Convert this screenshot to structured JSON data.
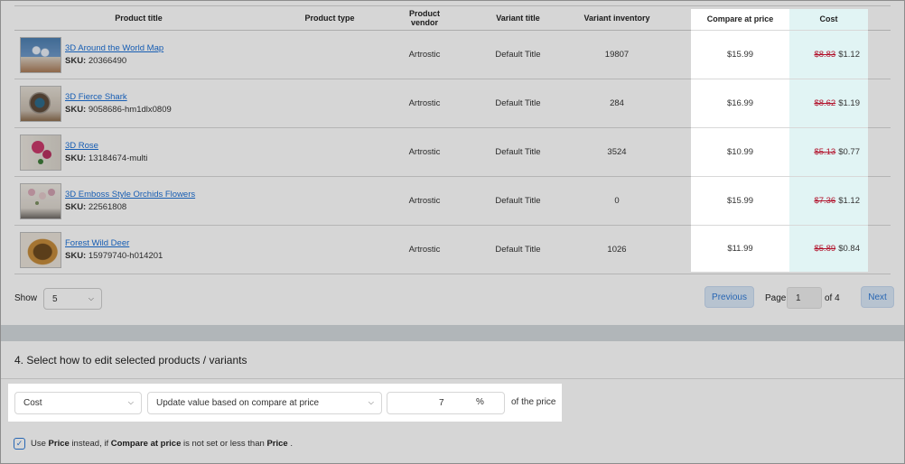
{
  "table": {
    "headers": {
      "title": "Product title",
      "type": "Product type",
      "vendor": "Product vendor",
      "variant_title": "Variant title",
      "inventory": "Variant inventory",
      "compare_at": "Compare at price",
      "cost": "Cost"
    },
    "rows": [
      {
        "title": "3D Around the World Map",
        "sku_label": "SKU:",
        "sku": "20366490",
        "type": "",
        "vendor": "Artrostic",
        "variant_title": "Default Title",
        "inventory": "19807",
        "compare_at": "$15.99",
        "cost_old": "$8.83",
        "cost_new": "$1.12"
      },
      {
        "title": "3D Fierce Shark",
        "sku_label": "SKU:",
        "sku": "9058686-hm1dlx0809",
        "type": "",
        "vendor": "Artrostic",
        "variant_title": "Default Title",
        "inventory": "284",
        "compare_at": "$16.99",
        "cost_old": "$8.62",
        "cost_new": "$1.19"
      },
      {
        "title": "3D Rose",
        "sku_label": "SKU:",
        "sku": "13184674-multi",
        "type": "",
        "vendor": "Artrostic",
        "variant_title": "Default Title",
        "inventory": "3524",
        "compare_at": "$10.99",
        "cost_old": "$5.13",
        "cost_new": "$0.77"
      },
      {
        "title": "3D Emboss Style Orchids Flowers",
        "sku_label": "SKU:",
        "sku": "22561808",
        "type": "",
        "vendor": "Artrostic",
        "variant_title": "Default Title",
        "inventory": "0",
        "compare_at": "$15.99",
        "cost_old": "$7.36",
        "cost_new": "$1.12"
      },
      {
        "title": "Forest Wild Deer",
        "sku_label": "SKU:",
        "sku": "15979740-h014201",
        "type": "",
        "vendor": "Artrostic",
        "variant_title": "Default Title",
        "inventory": "1026",
        "compare_at": "$11.99",
        "cost_old": "$5.89",
        "cost_new": "$0.84"
      }
    ]
  },
  "pagination": {
    "show_label": "Show",
    "page_size": "5",
    "previous": "Previous",
    "page_label": "Page",
    "current_page": "1",
    "of_label": "of 4",
    "next": "Next"
  },
  "edit": {
    "title": "4. Select how to edit selected products / variants",
    "field": "Cost",
    "mode": "Update value based on compare at price",
    "percent_value": "7",
    "percent_sign": "%",
    "suffix": "of the price",
    "checkbox_checked": true,
    "checkbox_text": {
      "use": "Use",
      "price1": "Price",
      "instead": "instead, if",
      "compare": "Compare at price",
      "not_set": "is not set or less than",
      "price2": "Price",
      "end": "."
    }
  },
  "icons": {
    "select_chevron": "chevron-down-icon",
    "checkbox": "check-icon"
  },
  "colors": {
    "link": "#1b6fd6",
    "strike": "#b2132c",
    "cost_highlight": "#e1f4f4",
    "button_bg": "#dbe9f8",
    "button_text": "#2f7ad6"
  }
}
